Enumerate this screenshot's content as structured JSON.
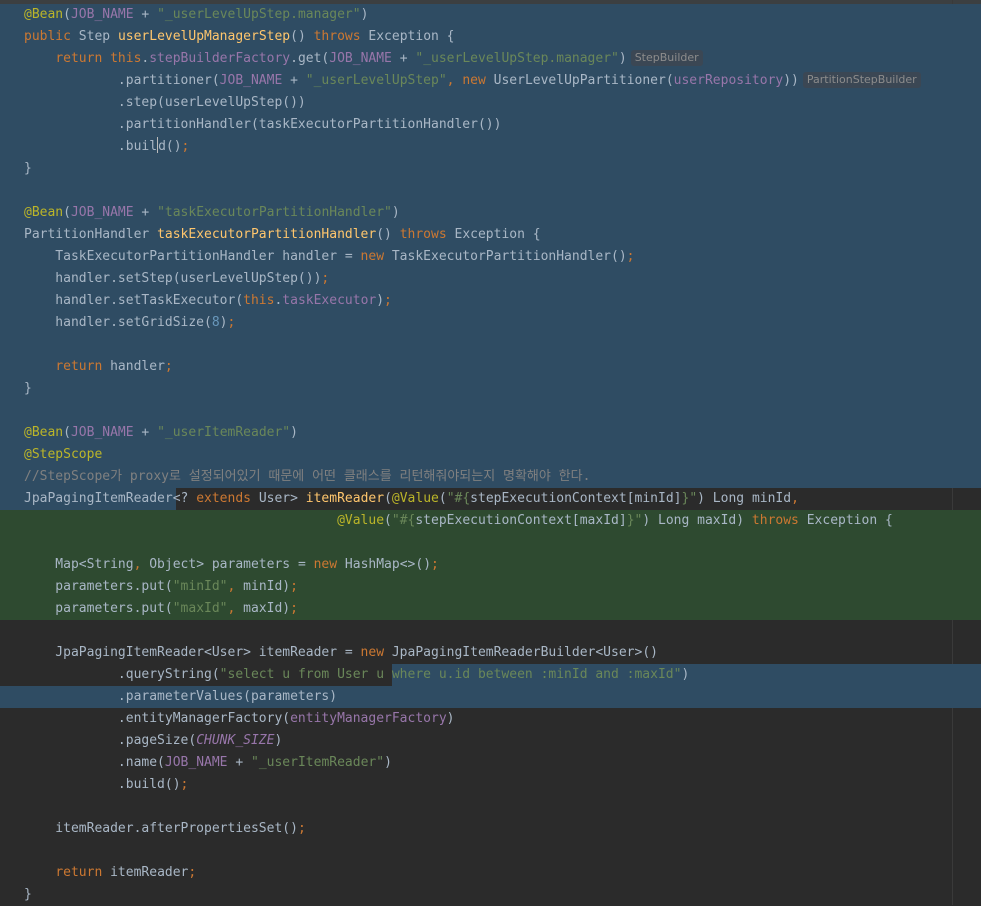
{
  "editor": {
    "lines": [
      [
        {
          "c": "an",
          "t": "@Bean"
        },
        {
          "c": "pl",
          "t": "("
        },
        {
          "c": "fd",
          "t": "JOB_NAME"
        },
        {
          "c": "pl",
          "t": " + "
        },
        {
          "c": "st",
          "t": "\"_userLevelUpStep.manager\""
        },
        {
          "c": "pl",
          "t": ")"
        }
      ],
      [
        {
          "c": "kw",
          "t": "public "
        },
        {
          "c": "pl",
          "t": "Step "
        },
        {
          "c": "fn",
          "t": "userLevelUpManagerStep"
        },
        {
          "c": "pl",
          "t": "() "
        },
        {
          "c": "kw",
          "t": "throws "
        },
        {
          "c": "pl",
          "t": "Exception {"
        }
      ],
      [
        {
          "c": "pl",
          "t": "    "
        },
        {
          "c": "kw",
          "t": "return this"
        },
        {
          "c": "pl",
          "t": "."
        },
        {
          "c": "fd",
          "t": "stepBuilderFactory"
        },
        {
          "c": "pl",
          "t": ".get("
        },
        {
          "c": "fd",
          "t": "JOB_NAME"
        },
        {
          "c": "pl",
          "t": " + "
        },
        {
          "c": "st",
          "t": "\"_userLevelUpStep.manager\""
        },
        {
          "c": "pl",
          "t": ")"
        },
        {
          "c": "hint",
          "t": "StepBuilder"
        }
      ],
      [
        {
          "c": "pl",
          "t": "            .partitioner("
        },
        {
          "c": "fd",
          "t": "JOB_NAME"
        },
        {
          "c": "pl",
          "t": " + "
        },
        {
          "c": "st",
          "t": "\"_userLevelUpStep\""
        },
        {
          "c": "sm",
          "t": ", "
        },
        {
          "c": "kw",
          "t": "new "
        },
        {
          "c": "pl",
          "t": "UserLevelUpPartitioner("
        },
        {
          "c": "fd",
          "t": "userRepository"
        },
        {
          "c": "pl",
          "t": "))"
        },
        {
          "c": "hint",
          "t": "PartitionStepBuilder"
        }
      ],
      [
        {
          "c": "pl",
          "t": "            .step(userLevelUpStep())"
        }
      ],
      [
        {
          "c": "pl",
          "t": "            .partitionHandler(taskExecutorPartitionHandler())"
        }
      ],
      [
        {
          "c": "pl",
          "t": "            .buil"
        },
        {
          "c": "caret",
          "t": ""
        },
        {
          "c": "pl",
          "t": "d()"
        },
        {
          "c": "sm",
          "t": ";"
        }
      ],
      [
        {
          "c": "pl",
          "t": "}"
        }
      ],
      [],
      [
        {
          "c": "an",
          "t": "@Bean"
        },
        {
          "c": "pl",
          "t": "("
        },
        {
          "c": "fd",
          "t": "JOB_NAME"
        },
        {
          "c": "pl",
          "t": " + "
        },
        {
          "c": "st",
          "t": "\"taskExecutorPartitionHandler\""
        },
        {
          "c": "pl",
          "t": ")"
        }
      ],
      [
        {
          "c": "pl",
          "t": "PartitionHandler "
        },
        {
          "c": "fn",
          "t": "taskExecutorPartitionHandler"
        },
        {
          "c": "pl",
          "t": "() "
        },
        {
          "c": "kw",
          "t": "throws "
        },
        {
          "c": "pl",
          "t": "Exception {"
        }
      ],
      [
        {
          "c": "pl",
          "t": "    TaskExecutorPartitionHandler handler = "
        },
        {
          "c": "kw",
          "t": "new "
        },
        {
          "c": "pl",
          "t": "TaskExecutorPartitionHandler()"
        },
        {
          "c": "sm",
          "t": ";"
        }
      ],
      [
        {
          "c": "pl",
          "t": "    handler.setStep(userLevelUpStep())"
        },
        {
          "c": "sm",
          "t": ";"
        }
      ],
      [
        {
          "c": "pl",
          "t": "    handler.setTaskExecutor("
        },
        {
          "c": "kw",
          "t": "this"
        },
        {
          "c": "pl",
          "t": "."
        },
        {
          "c": "fd",
          "t": "taskExecutor"
        },
        {
          "c": "pl",
          "t": ")"
        },
        {
          "c": "sm",
          "t": ";"
        }
      ],
      [
        {
          "c": "pl",
          "t": "    handler.setGridSize("
        },
        {
          "c": "nm",
          "t": "8"
        },
        {
          "c": "pl",
          "t": ")"
        },
        {
          "c": "sm",
          "t": ";"
        }
      ],
      [],
      [
        {
          "c": "pl",
          "t": "    "
        },
        {
          "c": "kw",
          "t": "return "
        },
        {
          "c": "pl",
          "t": "handler"
        },
        {
          "c": "sm",
          "t": ";"
        }
      ],
      [
        {
          "c": "pl",
          "t": "}"
        }
      ],
      [],
      [
        {
          "c": "an",
          "t": "@Bean"
        },
        {
          "c": "pl",
          "t": "("
        },
        {
          "c": "fd",
          "t": "JOB_NAME"
        },
        {
          "c": "pl",
          "t": " + "
        },
        {
          "c": "st",
          "t": "\"_userItemReader\""
        },
        {
          "c": "pl",
          "t": ")"
        }
      ],
      [
        {
          "c": "an",
          "t": "@StepScope"
        }
      ],
      [
        {
          "c": "cm",
          "t": "//StepScope가 proxy로 설정되어있기 때문에 어떤 클래스를 리턴해줘야되는지 명확해야 한다."
        }
      ],
      [
        {
          "c": "pl",
          "t": "JpaPagingItemReader<? "
        },
        {
          "c": "kw",
          "t": "extends "
        },
        {
          "c": "pl",
          "t": "User> "
        },
        {
          "c": "fn",
          "t": "itemReader"
        },
        {
          "c": "pl",
          "t": "("
        },
        {
          "c": "an",
          "t": "@Value"
        },
        {
          "c": "pl",
          "t": "("
        },
        {
          "c": "st",
          "t": "\"#{"
        },
        {
          "c": "pl",
          "t": "stepExecutionContext[minId]"
        },
        {
          "c": "st",
          "t": "}\""
        },
        {
          "c": "pl",
          "t": ") Long minId"
        },
        {
          "c": "sm",
          "t": ","
        }
      ],
      [
        {
          "c": "pl",
          "t": "                                        "
        },
        {
          "c": "an",
          "t": "@Value"
        },
        {
          "c": "pl",
          "t": "("
        },
        {
          "c": "st",
          "t": "\"#{"
        },
        {
          "c": "pl",
          "t": "stepExecutionContext[maxId]"
        },
        {
          "c": "st",
          "t": "}\""
        },
        {
          "c": "pl",
          "t": ") Long maxId) "
        },
        {
          "c": "kw",
          "t": "throws "
        },
        {
          "c": "pl",
          "t": "Exception {"
        }
      ],
      [],
      [
        {
          "c": "pl",
          "t": "    Map<String"
        },
        {
          "c": "sm",
          "t": ", "
        },
        {
          "c": "pl",
          "t": "Object> parameters = "
        },
        {
          "c": "kw",
          "t": "new "
        },
        {
          "c": "pl",
          "t": "HashMap<>()"
        },
        {
          "c": "sm",
          "t": ";"
        }
      ],
      [
        {
          "c": "pl",
          "t": "    parameters.put("
        },
        {
          "c": "st",
          "t": "\"minId\""
        },
        {
          "c": "sm",
          "t": ", "
        },
        {
          "c": "pl",
          "t": "minId)"
        },
        {
          "c": "sm",
          "t": ";"
        }
      ],
      [
        {
          "c": "pl",
          "t": "    parameters.put("
        },
        {
          "c": "st",
          "t": "\"maxId\""
        },
        {
          "c": "sm",
          "t": ", "
        },
        {
          "c": "pl",
          "t": "maxId)"
        },
        {
          "c": "sm",
          "t": ";"
        }
      ],
      [],
      [
        {
          "c": "pl",
          "t": "    JpaPagingItemReader<User> itemReader = "
        },
        {
          "c": "kw",
          "t": "new "
        },
        {
          "c": "pl",
          "t": "JpaPagingItemReaderBuilder<User>()"
        }
      ],
      [
        {
          "c": "pl",
          "t": "            .queryString("
        },
        {
          "c": "st",
          "t": "\"select u from User u where u.id between :minId and :maxId\""
        },
        {
          "c": "pl",
          "t": ")"
        }
      ],
      [
        {
          "c": "pl",
          "t": "            .parameterValues(parameters)"
        }
      ],
      [
        {
          "c": "pl",
          "t": "            .entityManagerFactory("
        },
        {
          "c": "fd",
          "t": "entityManagerFactory"
        },
        {
          "c": "pl",
          "t": ")"
        }
      ],
      [
        {
          "c": "pl",
          "t": "            .pageSize("
        },
        {
          "c": "cn",
          "t": "CHUNK_SIZE"
        },
        {
          "c": "pl",
          "t": ")"
        }
      ],
      [
        {
          "c": "pl",
          "t": "            .name("
        },
        {
          "c": "fd",
          "t": "JOB_NAME"
        },
        {
          "c": "pl",
          "t": " + "
        },
        {
          "c": "st",
          "t": "\"_userItemReader\""
        },
        {
          "c": "pl",
          "t": ")"
        }
      ],
      [
        {
          "c": "pl",
          "t": "            .build()"
        },
        {
          "c": "sm",
          "t": ";"
        }
      ],
      [],
      [
        {
          "c": "pl",
          "t": "    itemReader.afterPropertiesSet()"
        },
        {
          "c": "sm",
          "t": ";"
        }
      ],
      [],
      [
        {
          "c": "pl",
          "t": "    "
        },
        {
          "c": "kw",
          "t": "return "
        },
        {
          "c": "pl",
          "t": "itemReader"
        },
        {
          "c": "sm",
          "t": ";"
        }
      ],
      [
        {
          "c": "pl",
          "t": "}"
        }
      ]
    ]
  }
}
